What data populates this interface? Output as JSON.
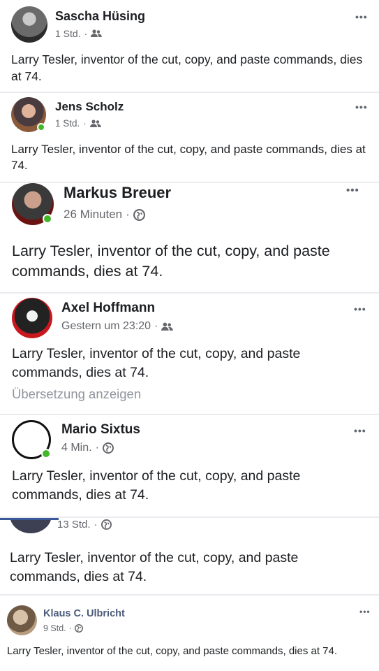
{
  "colors": {
    "name": "#1c1e21",
    "meta": "#65676b",
    "online": "#42b72a",
    "background": "#e9ebee"
  },
  "posts": [
    {
      "author": "Sascha Hüsing",
      "time": "1 Std.",
      "audience_icon": "friends-icon",
      "text": "Larry Tesler, inventor of the cut, copy, and paste commands, dies at 74."
    },
    {
      "author": "Jens Scholz",
      "time": "1 Std.",
      "audience_icon": "friends-icon",
      "text": "Larry Tesler, inventor of the cut, copy, and paste commands, dies at 74."
    },
    {
      "author": "Markus Breuer",
      "time": "26 Minuten",
      "audience_icon": "globe-icon",
      "text": "Larry Tesler, inventor of the cut, copy, and paste commands, dies at 74."
    },
    {
      "author": "Axel Hoffmann",
      "time": "Gestern um 23:20",
      "audience_icon": "friends-icon",
      "text": "Larry Tesler, inventor of the cut, copy, and paste commands, dies at 74.",
      "translate_link": "Übersetzung anzeigen"
    },
    {
      "author": "Mario Sixtus",
      "time": "4 Min.",
      "audience_icon": "globe-icon",
      "text": "Larry Tesler, inventor of the cut, copy, and paste commands, dies at 74."
    },
    {
      "author": "",
      "time": "13 Std.",
      "audience_icon": "globe-icon",
      "text": "Larry Tesler, inventor of the cut, copy, and paste commands, dies at 74."
    },
    {
      "author": "Klaus C. Ulbricht",
      "time": "9 Std.",
      "audience_icon": "globe-icon",
      "text": "Larry Tesler, inventor of the cut, copy, and paste commands, dies at 74."
    }
  ],
  "more_label": "•••",
  "meta_separator": "·"
}
